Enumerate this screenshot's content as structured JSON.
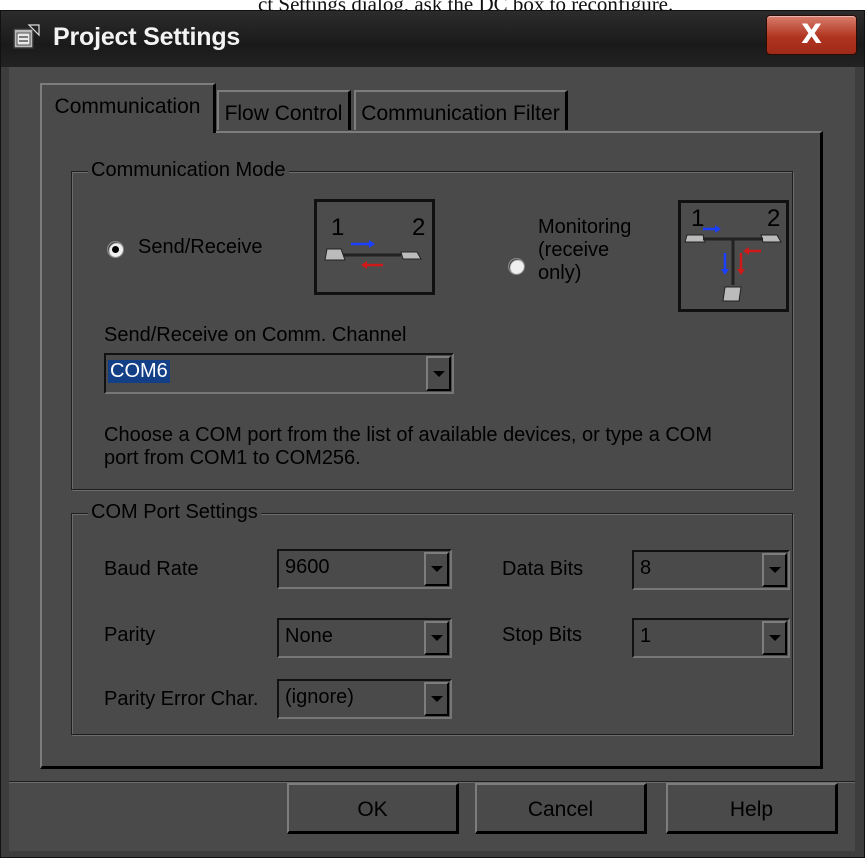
{
  "page_text": "ct Settings dialog, ask the DC box to reconfigure.",
  "window": {
    "title": "Project Settings",
    "close_label": "X"
  },
  "tabs": [
    {
      "label": "Communication",
      "active": true
    },
    {
      "label": "Flow Control",
      "active": false
    },
    {
      "label": "Communication Filter",
      "active": false
    }
  ],
  "comm_mode": {
    "legend": "Communication Mode",
    "send_receive_label": "Send/Receive",
    "monitoring_label_1": "Monitoring",
    "monitoring_label_2": "(receive",
    "monitoring_label_3": "only)",
    "selected": "send_receive",
    "diagram1_node_1": "1",
    "diagram1_node_2": "2",
    "diagram2_node_1": "1",
    "diagram2_node_2": "2",
    "channel_label": "Send/Receive on Comm. Channel",
    "channel_value": "COM6",
    "help_text_1": "Choose a COM port from the list of available devices, or type a COM",
    "help_text_2": "port from COM1 to COM256."
  },
  "port_settings": {
    "legend": "COM Port Settings",
    "baud_rate_label": "Baud Rate",
    "baud_rate_value": "9600",
    "data_bits_label": "Data Bits",
    "data_bits_value": "8",
    "parity_label": "Parity",
    "parity_value": "None",
    "stop_bits_label": "Stop Bits",
    "stop_bits_value": "1",
    "parity_error_label": "Parity Error Char.",
    "parity_error_value": "(ignore)"
  },
  "buttons": {
    "ok": "OK",
    "cancel": "Cancel",
    "help": "Help"
  },
  "colors": {
    "arrow_blue": "#1b3fff",
    "arrow_red": "#d01a1a",
    "close_button": "#b03520",
    "selection": "#123f86"
  }
}
